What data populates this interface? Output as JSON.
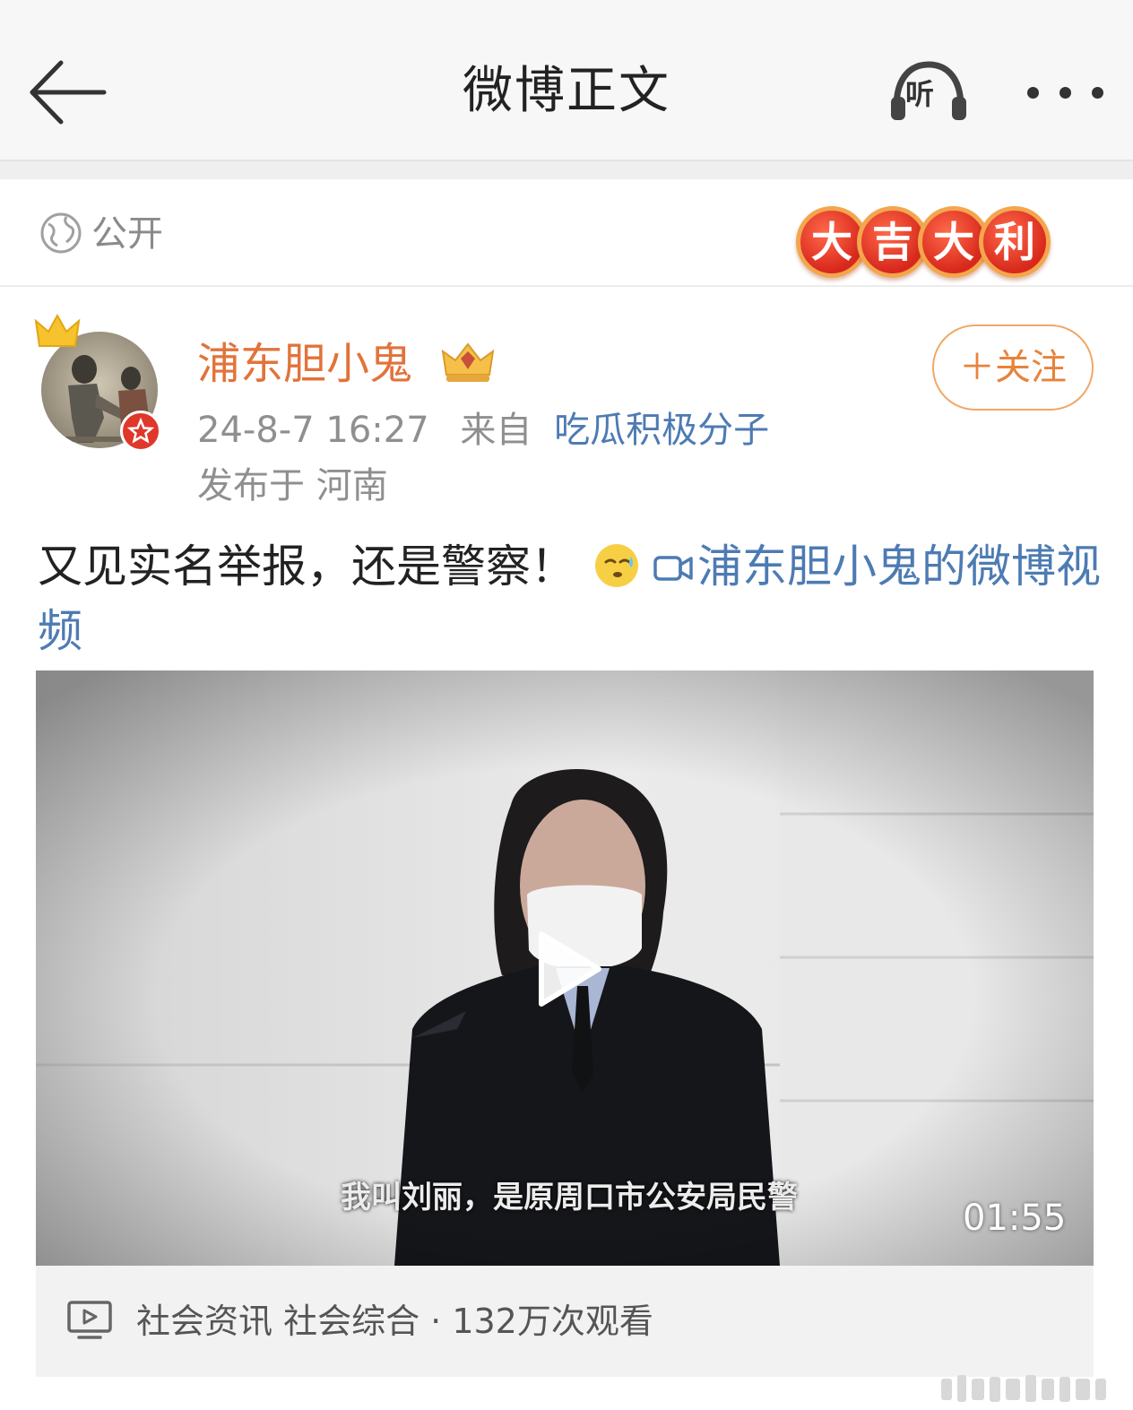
{
  "header": {
    "title": "微博正文",
    "listen_label": "听"
  },
  "visibility": {
    "label": "公开",
    "badge_chars": [
      "大",
      "吉",
      "大",
      "利"
    ]
  },
  "author": {
    "name": "浦东胆小鬼",
    "time": "24-8-7 16:27",
    "from_label": "来自",
    "source": "吃瓜积极分子",
    "location": "发布于 河南",
    "follow_label": "＋关注"
  },
  "post": {
    "text": "又见实名举报，还是警察！",
    "video_link": "浦东胆小鬼的微博视频"
  },
  "video": {
    "subtitle": "我叫刘丽，是原周口市公安局民警",
    "duration": "01:55",
    "footer": "社会资讯 社会综合 · 132万次观看"
  },
  "colors": {
    "accent_orange": "#e2733a",
    "link_blue": "#4d7bb3",
    "badge_red": "#d8281c"
  }
}
